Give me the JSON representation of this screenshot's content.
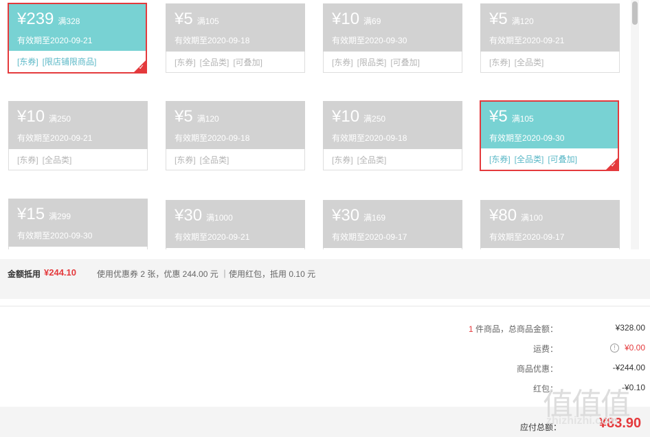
{
  "coupons": [
    {
      "amount": "¥239",
      "condition": "满328",
      "valid": "有效期至2020-09-21",
      "tags": [
        "[东券]",
        "[限店铺限商品]"
      ],
      "selected": true
    },
    {
      "amount": "¥5",
      "condition": "满105",
      "valid": "有效期至2020-09-18",
      "tags": [
        "[东券]",
        "[全品类]",
        "[可叠加]"
      ],
      "selected": false
    },
    {
      "amount": "¥10",
      "condition": "满69",
      "valid": "有效期至2020-09-30",
      "tags": [
        "[东券]",
        "[限品类]",
        "[可叠加]"
      ],
      "selected": false
    },
    {
      "amount": "¥5",
      "condition": "满120",
      "valid": "有效期至2020-09-21",
      "tags": [
        "[东券]",
        "[全品类]"
      ],
      "selected": false
    },
    {
      "amount": "¥10",
      "condition": "满250",
      "valid": "有效期至2020-09-21",
      "tags": [
        "[东券]",
        "[全品类]"
      ],
      "selected": false
    },
    {
      "amount": "¥5",
      "condition": "满120",
      "valid": "有效期至2020-09-18",
      "tags": [
        "[东券]",
        "[全品类]"
      ],
      "selected": false
    },
    {
      "amount": "¥10",
      "condition": "满250",
      "valid": "有效期至2020-09-18",
      "tags": [
        "[东券]",
        "[全品类]"
      ],
      "selected": false
    },
    {
      "amount": "¥5",
      "condition": "满105",
      "valid": "有效期至2020-09-30",
      "tags": [
        "[东券]",
        "[全品类]",
        "[可叠加]"
      ],
      "selected": true
    },
    {
      "amount": "¥15",
      "condition": "满299",
      "valid": "有效期至2020-09-30",
      "tags": [],
      "selected": false
    },
    {
      "amount": "¥30",
      "condition": "满1000",
      "valid": "有效期至2020-09-21",
      "tags": [],
      "selected": false
    },
    {
      "amount": "¥30",
      "condition": "满169",
      "valid": "有效期至2020-09-17",
      "tags": [],
      "selected": false
    },
    {
      "amount": "¥80",
      "condition": "满100",
      "valid": "有效期至2020-09-17",
      "tags": [],
      "selected": false
    }
  ],
  "summary": {
    "label": "金额抵用",
    "amount": "¥244.10",
    "detail": "使用优惠券 2 张，优惠 244.00 元 ｜使用红包，抵用 0.10 元"
  },
  "totals": {
    "items_count": "1",
    "items_label": " 件商品，总商品金额：",
    "items_value": "¥328.00",
    "shipping_label": "运费：",
    "shipping_value": "¥0.00",
    "discount_label": "商品优惠：",
    "discount_value": "-¥244.00",
    "redpacket_label": "红包：",
    "redpacket_value": "-¥0.10"
  },
  "pay": {
    "label": "应付总额：",
    "value": "¥83.90"
  },
  "watermark": {
    "text": "值值值",
    "url": "zhizhizhi.com"
  },
  "colors": {
    "accent": "#e4393c",
    "selected_coupon": "#78d2d3",
    "inactive_coupon": "#d2d2d2"
  }
}
